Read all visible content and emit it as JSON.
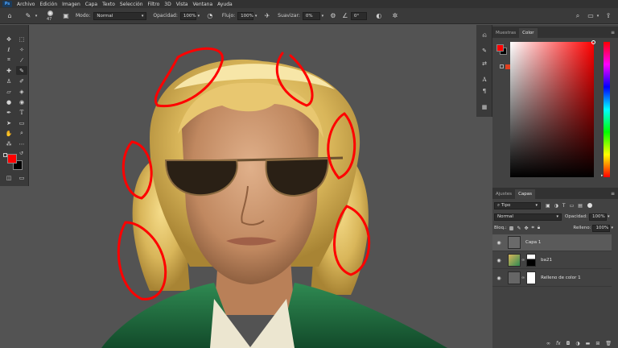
{
  "menu": {
    "logo": "Ps",
    "items": [
      "Archivo",
      "Edición",
      "Imagen",
      "Capa",
      "Texto",
      "Selección",
      "Filtro",
      "3D",
      "Vista",
      "Ventana",
      "Ayuda"
    ]
  },
  "options": {
    "brush_size": "47",
    "mode_label": "Modo:",
    "mode_value": "Normal",
    "opacity_label": "Opacidad:",
    "opacity_value": "100%",
    "flow_label": "Flujo:",
    "flow_value": "100%",
    "smooth_label": "Suavizar:",
    "smooth_value": "0%",
    "angle_value": "0°"
  },
  "panels": {
    "swatches_tab": "Muestras",
    "color_tab": "Color",
    "adjustments_tab": "Ajustes",
    "layers_tab": "Capas"
  },
  "layers": {
    "filter_kind": "Tipo",
    "blend_mode": "Normal",
    "opacity_label": "Opacidad:",
    "opacity_value": "100%",
    "lock_label": "Bloq.:",
    "fill_label": "Relleno:",
    "fill_value": "100%",
    "items": [
      {
        "name": "Capa 1"
      },
      {
        "name": "ba21"
      },
      {
        "name": "Relleno de color 1"
      }
    ]
  },
  "colors": {
    "foreground": "#ff0000",
    "background": "#000000",
    "annotation": "#ff0000"
  }
}
